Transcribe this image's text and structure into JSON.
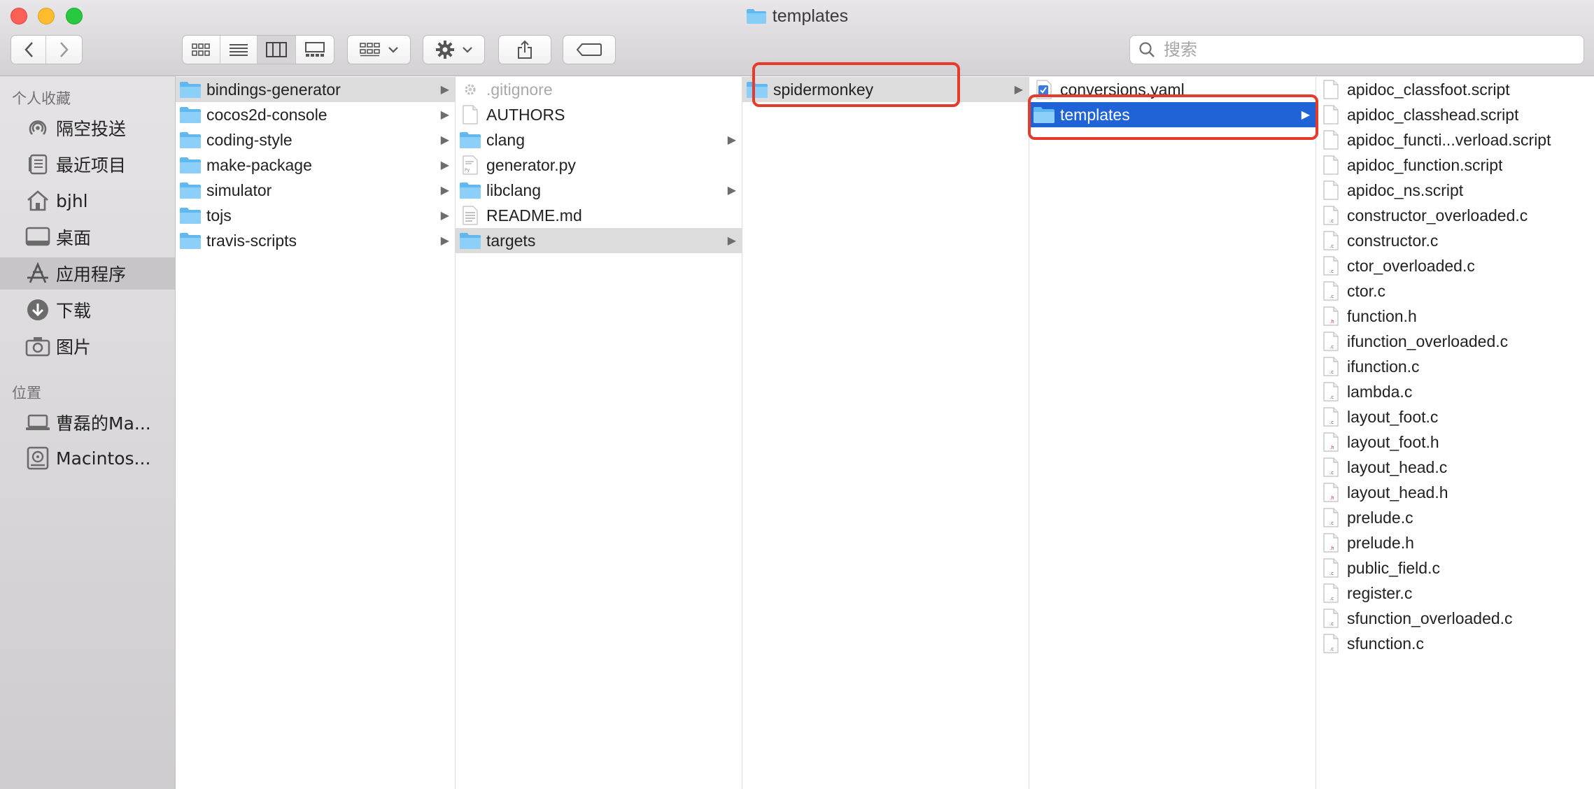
{
  "window": {
    "title": "templates"
  },
  "search": {
    "placeholder": "搜索"
  },
  "sidebar": {
    "favorites_header": "个人收藏",
    "favorites": [
      {
        "label": "隔空投送",
        "icon": "airdrop-icon"
      },
      {
        "label": "最近项目",
        "icon": "recents-icon"
      },
      {
        "label": "bjhl",
        "icon": "home-icon"
      },
      {
        "label": "桌面",
        "icon": "desktop-icon"
      },
      {
        "label": "应用程序",
        "icon": "applications-icon",
        "selected": true
      },
      {
        "label": "下载",
        "icon": "download-icon"
      },
      {
        "label": "图片",
        "icon": "camera-icon"
      }
    ],
    "locations_header": "位置",
    "locations": [
      {
        "label": "曹磊的Ma...",
        "icon": "laptop-icon"
      },
      {
        "label": "Macintos...",
        "icon": "hard-disk-icon"
      }
    ]
  },
  "columns": [
    {
      "items": [
        {
          "label": "bindings-generator",
          "kind": "folder",
          "state": "path",
          "has_children": true
        },
        {
          "label": "cocos2d-console",
          "kind": "folder",
          "has_children": true
        },
        {
          "label": "coding-style",
          "kind": "folder",
          "has_children": true
        },
        {
          "label": "make-package",
          "kind": "folder",
          "has_children": true
        },
        {
          "label": "simulator",
          "kind": "folder",
          "has_children": true
        },
        {
          "label": "tojs",
          "kind": "folder",
          "has_children": true
        },
        {
          "label": "travis-scripts",
          "kind": "folder",
          "has_children": true
        }
      ]
    },
    {
      "items": [
        {
          "label": ".gitignore",
          "kind": "gear-file",
          "state": "dim"
        },
        {
          "label": "AUTHORS",
          "kind": "doc"
        },
        {
          "label": "clang",
          "kind": "folder",
          "has_children": true
        },
        {
          "label": "generator.py",
          "kind": "py"
        },
        {
          "label": "libclang",
          "kind": "folder",
          "has_children": true
        },
        {
          "label": "README.md",
          "kind": "text"
        },
        {
          "label": "targets",
          "kind": "folder",
          "state": "path",
          "has_children": true
        }
      ]
    },
    {
      "items": [
        {
          "label": "spidermonkey",
          "kind": "folder",
          "state": "path",
          "has_children": true
        }
      ]
    },
    {
      "items": [
        {
          "label": "conversions.yaml",
          "kind": "yaml"
        },
        {
          "label": "templates",
          "kind": "folder",
          "state": "active",
          "has_children": true
        }
      ]
    },
    {
      "items": [
        {
          "label": "apidoc_classfoot.script",
          "kind": "doc"
        },
        {
          "label": "apidoc_classhead.script",
          "kind": "doc"
        },
        {
          "label": "apidoc_functi...verload.script",
          "kind": "doc"
        },
        {
          "label": "apidoc_function.script",
          "kind": "doc"
        },
        {
          "label": "apidoc_ns.script",
          "kind": "doc"
        },
        {
          "label": "constructor_overloaded.c",
          "kind": "c"
        },
        {
          "label": "constructor.c",
          "kind": "c"
        },
        {
          "label": "ctor_overloaded.c",
          "kind": "c"
        },
        {
          "label": "ctor.c",
          "kind": "c"
        },
        {
          "label": "function.h",
          "kind": "h"
        },
        {
          "label": "ifunction_overloaded.c",
          "kind": "c"
        },
        {
          "label": "ifunction.c",
          "kind": "c"
        },
        {
          "label": "lambda.c",
          "kind": "c"
        },
        {
          "label": "layout_foot.c",
          "kind": "c"
        },
        {
          "label": "layout_foot.h",
          "kind": "h"
        },
        {
          "label": "layout_head.c",
          "kind": "c"
        },
        {
          "label": "layout_head.h",
          "kind": "h"
        },
        {
          "label": "prelude.c",
          "kind": "c"
        },
        {
          "label": "prelude.h",
          "kind": "h"
        },
        {
          "label": "public_field.c",
          "kind": "c"
        },
        {
          "label": "register.c",
          "kind": "c"
        },
        {
          "label": "sfunction_overloaded.c",
          "kind": "c"
        },
        {
          "label": "sfunction.c",
          "kind": "c"
        }
      ]
    }
  ],
  "colors": {
    "selection": "#1f63d7",
    "highlight_box": "#e63a2c",
    "folder": "#6cc4f5"
  }
}
